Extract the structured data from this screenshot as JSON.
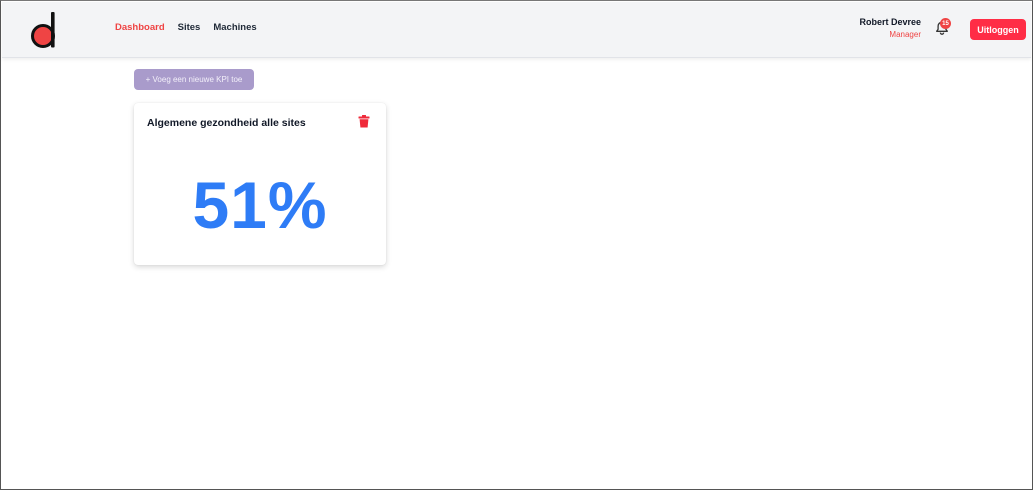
{
  "nav": {
    "links": [
      "Dashboard",
      "Sites",
      "Machines"
    ],
    "active": "Dashboard"
  },
  "user": {
    "name": "Robert Devree",
    "role": "Manager"
  },
  "notifications": {
    "count": "15"
  },
  "logout_label": "Uitloggen",
  "add_kpi_label": "+ Voeg een nieuwe KPI toe",
  "kpi_cards": [
    {
      "title": "Algemene gezondheid alle sites",
      "value": "51%"
    }
  ],
  "colors": {
    "accent": "#ef4444",
    "logout_bg": "#ff2d46",
    "add_button_bg": "#a99bcb",
    "kpi_value": "#2e7cf6"
  },
  "icons": {
    "logo": "logo-d-icon",
    "bell": "bell-icon",
    "delete": "trash-icon"
  }
}
